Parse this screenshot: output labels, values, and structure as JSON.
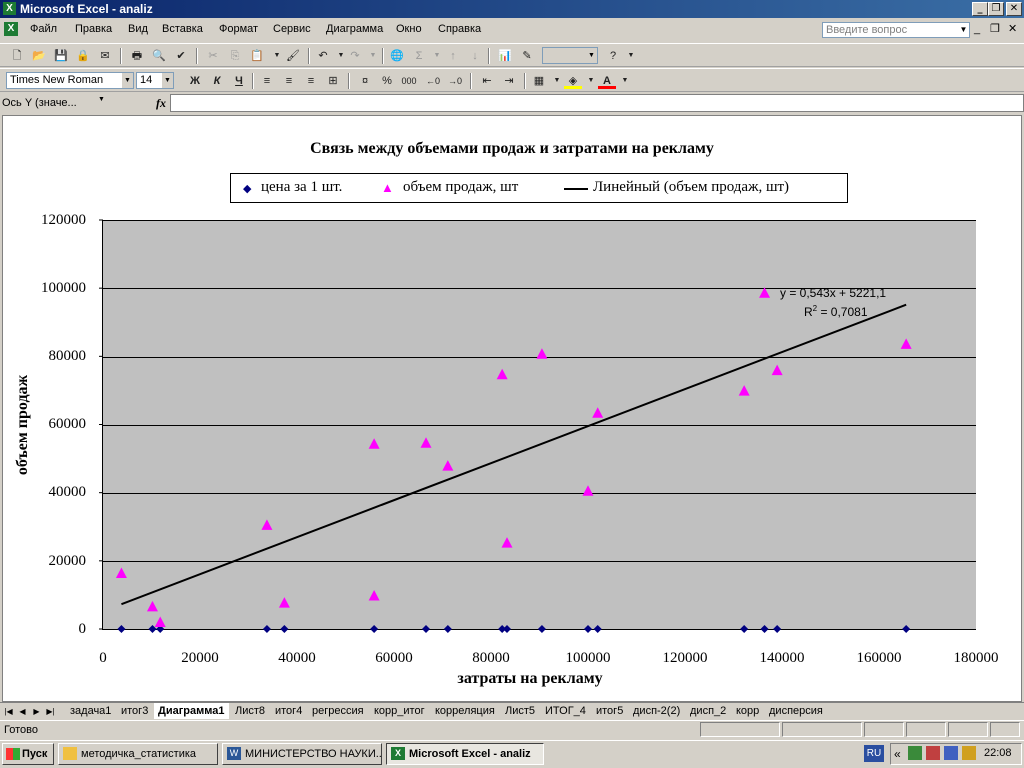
{
  "window": {
    "title": "Microsoft Excel - analiz",
    "app_icon": "X",
    "controls": [
      "_",
      "❐",
      "✕"
    ],
    "doc_controls": [
      "_",
      "❐",
      "✕"
    ]
  },
  "menu": {
    "items": [
      "Файл",
      "Правка",
      "Вид",
      "Вставка",
      "Формат",
      "Сервис",
      "Диаграмма",
      "Окно",
      "Справка"
    ],
    "ask_placeholder": "Введите вопрос"
  },
  "toolbar_format": {
    "font_name": "Times New Roman",
    "font_size": "14",
    "bold": "Ж",
    "italic": "К",
    "underline": "Ч",
    "percent": "%",
    "thousands": "000"
  },
  "formula_bar": {
    "name_box": "Ось Y (значе...",
    "fx": "fx",
    "value": ""
  },
  "chart_data": {
    "type": "scatter",
    "title": "Связь между объемами продаж и затратами на рекламу",
    "xlabel": "затраты на рекламу",
    "ylabel": "объем продаж",
    "xlim": [
      0,
      180000
    ],
    "ylim": [
      0,
      120000
    ],
    "x_ticks": [
      "0",
      "20000",
      "40000",
      "60000",
      "80000",
      "100000",
      "120000",
      "140000",
      "160000",
      "180000"
    ],
    "y_ticks": [
      "0",
      "20000",
      "40000",
      "60000",
      "80000",
      "100000",
      "120000"
    ],
    "grid": "horizontal",
    "legend_position": "top",
    "plot_background": "#c0c0c0",
    "series": [
      {
        "name": "цена за 1 шт.",
        "marker": "diamond",
        "color": "#000080",
        "points": [
          [
            3800,
            0
          ],
          [
            10200,
            0
          ],
          [
            11800,
            0
          ],
          [
            33800,
            0
          ],
          [
            37400,
            0
          ],
          [
            55900,
            0
          ],
          [
            66600,
            0
          ],
          [
            71100,
            0
          ],
          [
            82300,
            0
          ],
          [
            83300,
            0
          ],
          [
            90500,
            0
          ],
          [
            100000,
            0
          ],
          [
            102000,
            0
          ],
          [
            132200,
            0
          ],
          [
            136400,
            0
          ],
          [
            139000,
            0
          ],
          [
            165600,
            0
          ]
        ]
      },
      {
        "name": "объем продаж, шт",
        "marker": "triangle",
        "color": "#ff00ff",
        "points": [
          [
            3800,
            16300
          ],
          [
            10200,
            6500
          ],
          [
            11800,
            1900
          ],
          [
            33800,
            30400
          ],
          [
            37400,
            7600
          ],
          [
            55900,
            9700
          ],
          [
            55900,
            54200
          ],
          [
            66600,
            54500
          ],
          [
            71100,
            47800
          ],
          [
            82300,
            74600
          ],
          [
            83300,
            25200
          ],
          [
            90500,
            80600
          ],
          [
            100000,
            40400
          ],
          [
            102000,
            63300
          ],
          [
            132200,
            69800
          ],
          [
            136400,
            98500
          ],
          [
            139000,
            75800
          ],
          [
            165600,
            83500
          ]
        ]
      }
    ],
    "trendline": {
      "name": "Линейный (объем продаж, шт)",
      "color": "#000000",
      "slope": 0.543,
      "intercept": 5221.1,
      "x_range": [
        3800,
        165600
      ],
      "equation": "y = 0,543x + 5221,1",
      "r2_label": "R",
      "r2_sup": "2",
      "r2_value": " = 0,7081"
    }
  },
  "sheet_tabs": {
    "items": [
      "задача1",
      "итог3",
      "Диаграмма1",
      "Лист8",
      "итог4",
      "регрессия",
      "корр_итог",
      "корреляция",
      "Лист5",
      "ИТОГ_4",
      "итог5",
      "дисп-2(2)",
      "дисп_2",
      "корр",
      "дисперсия"
    ],
    "active": "Диаграмма1"
  },
  "status": {
    "text": "Готово"
  },
  "taskbar": {
    "start": "Пуск",
    "buttons": [
      "методичка_статистика",
      "МИНИСТЕРСТВО НАУКИ...",
      "Microsoft Excel - analiz"
    ],
    "active_index": 2,
    "lang": "RU",
    "tray_arrow": "«",
    "clock": "22:08"
  }
}
